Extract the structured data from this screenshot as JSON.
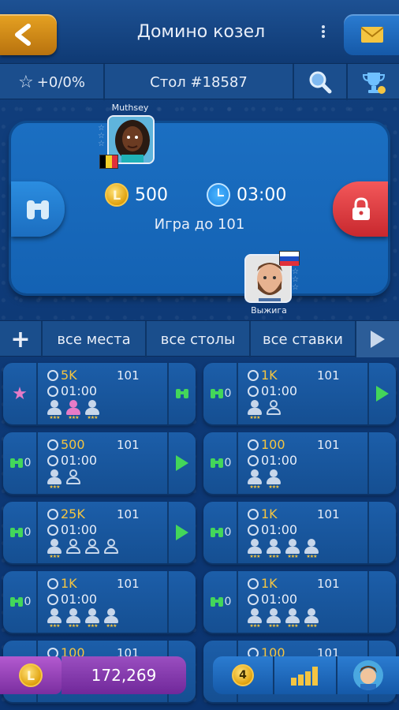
{
  "header": {
    "title": "Домино козел",
    "back_icon": "chevron-left-icon",
    "mail_icon": "mail-icon"
  },
  "info": {
    "rating": "+0/0%",
    "table": "Стол #18587"
  },
  "room": {
    "player_top": {
      "name": "Muthsey",
      "flag": "be"
    },
    "player_bottom": {
      "name": "Выжига",
      "flag": "ru"
    },
    "bet": "500",
    "time": "03:00",
    "goal": "Игра до 101"
  },
  "filters": {
    "add": "+",
    "places": "все места",
    "tables": "все столы",
    "stakes": "все ставки"
  },
  "tables": [
    {
      "left": "star",
      "stake": "5K",
      "goal": "101",
      "time": "01:00",
      "seats": [
        "filled",
        "pink",
        "filled"
      ],
      "right": "watch"
    },
    {
      "left": "0",
      "stake": "1K",
      "goal": "101",
      "time": "01:00",
      "seats": [
        "filled",
        "empty"
      ],
      "right": "play"
    },
    {
      "left": "0",
      "stake": "500",
      "goal": "101",
      "time": "01:00",
      "seats": [
        "filled",
        "empty"
      ],
      "right": "play"
    },
    {
      "left": "0",
      "stake": "100",
      "goal": "101",
      "time": "01:00",
      "seats": [
        "filled",
        "filled"
      ],
      "right": ""
    },
    {
      "left": "0",
      "stake": "25K",
      "goal": "101",
      "time": "01:00",
      "seats": [
        "filled",
        "empty",
        "empty",
        "empty"
      ],
      "right": "play"
    },
    {
      "left": "0",
      "stake": "1K",
      "goal": "101",
      "time": "01:00",
      "seats": [
        "filled",
        "filled",
        "filled",
        "filled"
      ],
      "right": ""
    },
    {
      "left": "0",
      "stake": "1K",
      "goal": "101",
      "time": "01:00",
      "seats": [
        "filled",
        "filled",
        "filled",
        "filled"
      ],
      "right": ""
    },
    {
      "left": "0",
      "stake": "1K",
      "goal": "101",
      "time": "01:00",
      "seats": [
        "filled",
        "filled",
        "filled",
        "filled"
      ],
      "right": ""
    },
    {
      "left": "",
      "stake": "100",
      "goal": "101",
      "time": "",
      "seats": [],
      "right": ""
    },
    {
      "left": "",
      "stake": "100",
      "goal": "101",
      "time": "",
      "seats": [],
      "right": ""
    }
  ],
  "bottom": {
    "balance": "172,269",
    "level": "4"
  },
  "colors": {
    "accent_orange": "#e6a222",
    "play_green": "#43d65a",
    "gold": "#f4c542"
  }
}
